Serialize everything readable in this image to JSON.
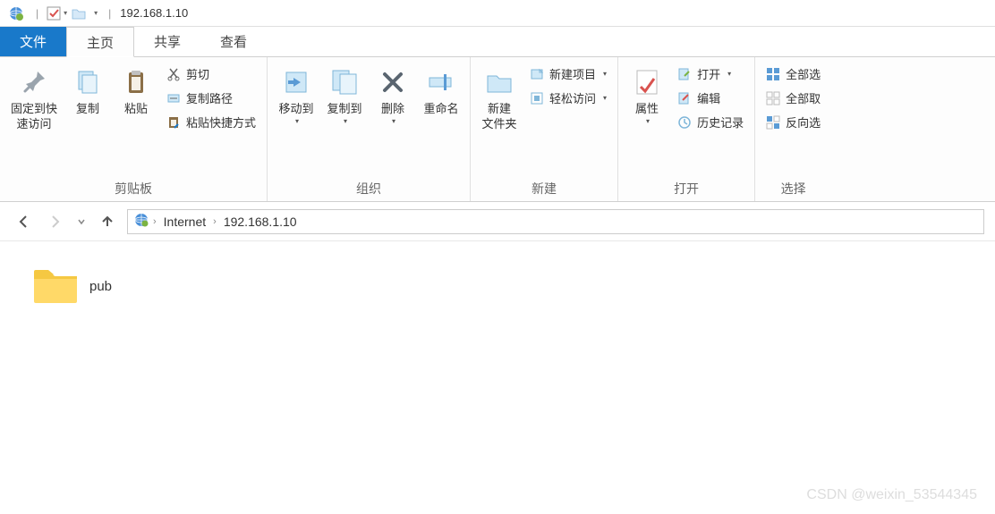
{
  "titlebar": {
    "title": "192.168.1.10"
  },
  "tabs": {
    "file": "文件",
    "home": "主页",
    "share": "共享",
    "view": "查看"
  },
  "ribbon": {
    "clipboard": {
      "label": "剪贴板",
      "pin": "固定到快\n速访问",
      "copy": "复制",
      "paste": "粘贴",
      "cut": "剪切",
      "copypath": "复制路径",
      "pasteshortcut": "粘贴快捷方式"
    },
    "organize": {
      "label": "组织",
      "moveto": "移动到",
      "copyto": "复制到",
      "delete": "删除",
      "rename": "重命名"
    },
    "new": {
      "label": "新建",
      "newfolder": "新建\n文件夹",
      "newitem": "新建项目",
      "easyaccess": "轻松访问"
    },
    "open": {
      "label": "打开",
      "properties": "属性",
      "open": "打开",
      "edit": "编辑",
      "history": "历史记录"
    },
    "select": {
      "label": "选择",
      "selectall": "全部选",
      "selectnone": "全部取",
      "invert": "反向选"
    }
  },
  "breadcrumb": {
    "root": "Internet",
    "current": "192.168.1.10"
  },
  "content": {
    "items": [
      {
        "name": "pub"
      }
    ]
  },
  "watermark": "CSDN @weixin_53544345"
}
